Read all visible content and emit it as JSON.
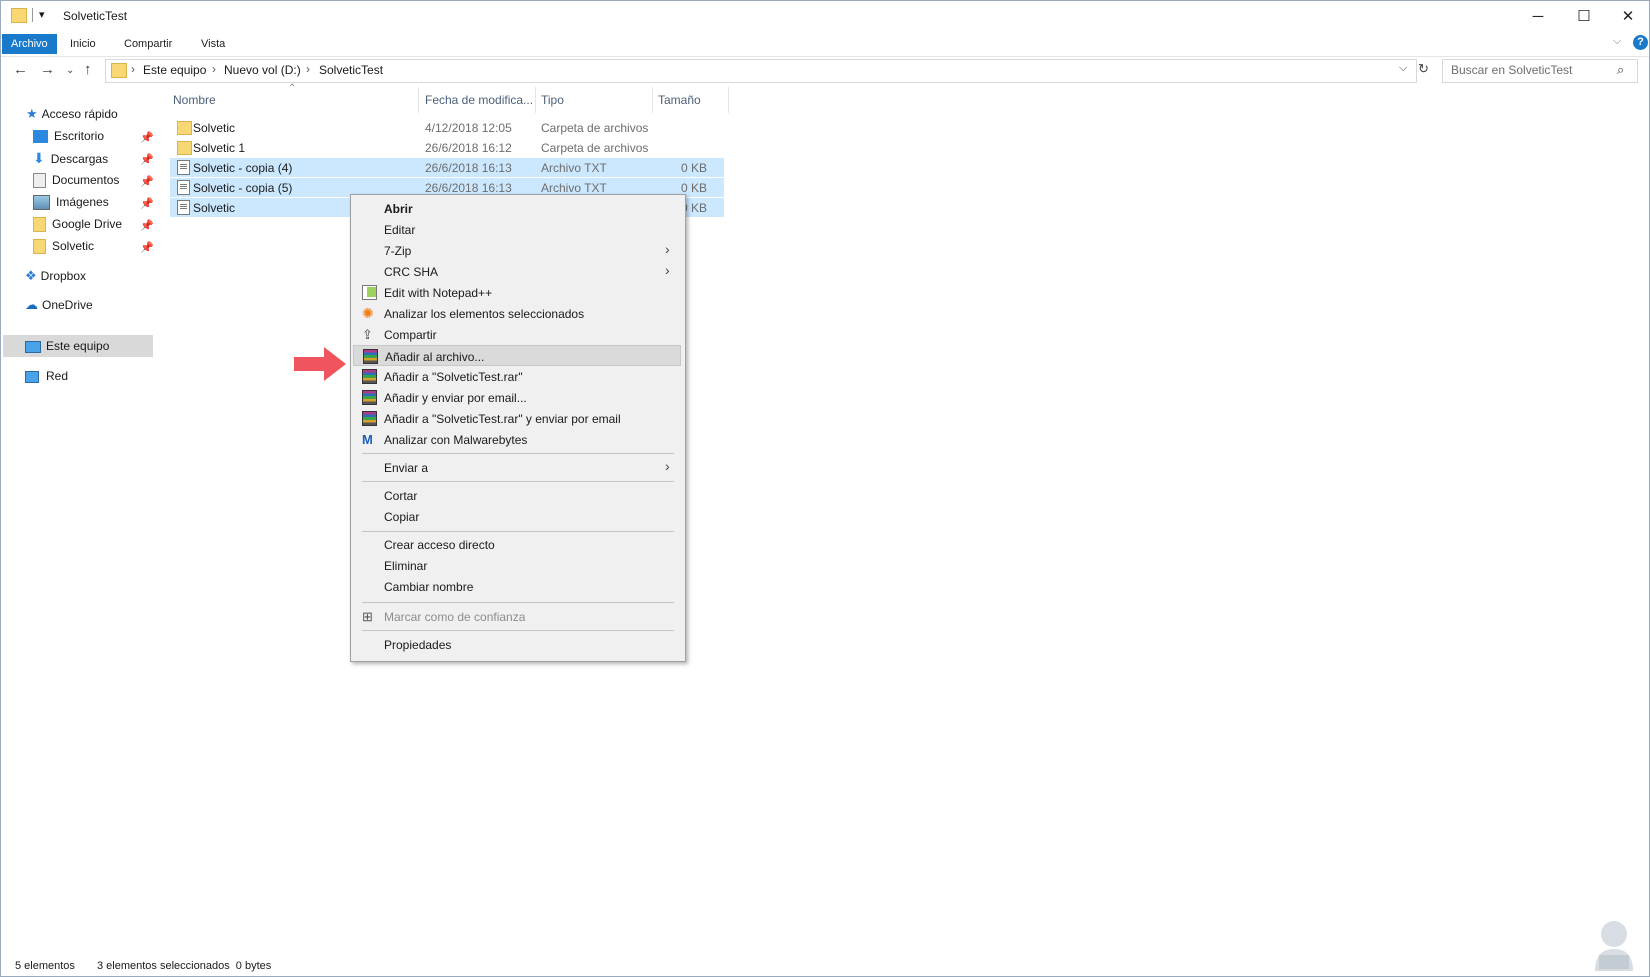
{
  "window": {
    "title": "SolveticTest"
  },
  "ribbon": {
    "tabs": [
      "Archivo",
      "Inicio",
      "Compartir",
      "Vista"
    ]
  },
  "address": {
    "crumbs": [
      "Este equipo",
      "Nuevo vol (D:)",
      "SolveticTest"
    ],
    "search_placeholder": "Buscar en SolveticTest"
  },
  "nav_pane": {
    "quick_access": "Acceso rápido",
    "pinned": [
      "Escritorio",
      "Descargas",
      "Documentos",
      "Imágenes",
      "Google Drive",
      "Solvetic"
    ],
    "others": [
      "Dropbox",
      "OneDrive",
      "Este equipo",
      "Red"
    ],
    "selected": "Este equipo"
  },
  "columns": {
    "name": "Nombre",
    "date": "Fecha de modifica...",
    "type": "Tipo",
    "size": "Tamaño"
  },
  "files": [
    {
      "name": "Solvetic",
      "date": "4/12/2018 12:05",
      "type": "Carpeta de archivos",
      "size": "",
      "kind": "folder",
      "selected": false
    },
    {
      "name": "Solvetic 1",
      "date": "26/6/2018 16:12",
      "type": "Carpeta de archivos",
      "size": "",
      "kind": "folder",
      "selected": false
    },
    {
      "name": "Solvetic - copia (4)",
      "date": "26/6/2018 16:13",
      "type": "Archivo TXT",
      "size": "0 KB",
      "kind": "txt",
      "selected": true
    },
    {
      "name": "Solvetic - copia (5)",
      "date": "26/6/2018 16:13",
      "type": "Archivo TXT",
      "size": "0 KB",
      "kind": "txt",
      "selected": true
    },
    {
      "name": "Solvetic",
      "date": "",
      "type": "",
      "size": "0 KB",
      "kind": "txt",
      "selected": true
    }
  ],
  "context_menu": {
    "items": [
      "Abrir",
      "Editar",
      "7-Zip",
      "CRC SHA",
      "Edit with Notepad++",
      "Analizar los elementos seleccionados",
      "Compartir",
      "Añadir al archivo...",
      "Añadir a \"SolveticTest.rar\"",
      "Añadir y enviar por email...",
      "Añadir a \"SolveticTest.rar\" y enviar por email",
      "Analizar con Malwarebytes",
      "Enviar a",
      "Cortar",
      "Copiar",
      "Crear acceso directo",
      "Eliminar",
      "Cambiar nombre",
      "Marcar como de confianza",
      "Propiedades"
    ],
    "highlighted": "Añadir al archivo..."
  },
  "status": {
    "count": "5 elementos",
    "selection": "3 elementos seleccionados  0 bytes"
  },
  "colors": {
    "accent": "#1979ca",
    "selection": "#cce8ff",
    "arrow": "#f0555f"
  }
}
